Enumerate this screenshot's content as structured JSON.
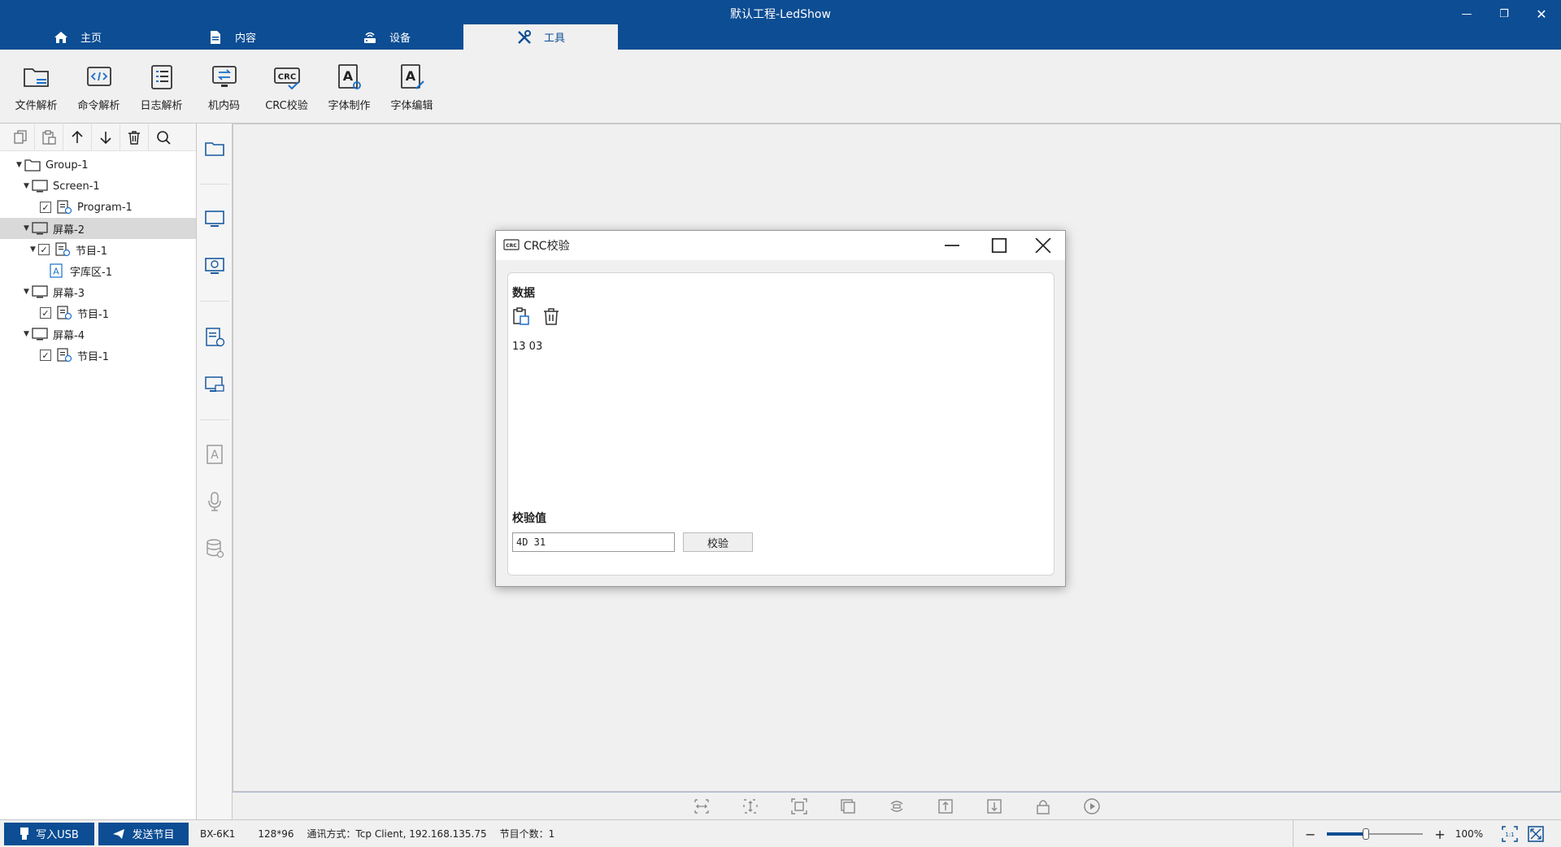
{
  "window": {
    "title": "默认工程-LedShow",
    "controls": {
      "minimize": "—",
      "restore": "❐",
      "close": "✕"
    }
  },
  "tabs": [
    {
      "label": "主页",
      "icon": "home-icon"
    },
    {
      "label": "内容",
      "icon": "document-icon"
    },
    {
      "label": "设备",
      "icon": "router-icon"
    },
    {
      "label": "工具",
      "icon": "tools-icon",
      "active": true
    }
  ],
  "ribbon": [
    {
      "label": "文件解析",
      "icon": "folder-parse-icon"
    },
    {
      "label": "命令解析",
      "icon": "code-icon"
    },
    {
      "label": "日志解析",
      "icon": "log-icon"
    },
    {
      "label": "机内码",
      "icon": "monitor-swap-icon"
    },
    {
      "label": "CRC校验",
      "icon": "crc-icon"
    },
    {
      "label": "字体制作",
      "icon": "font-make-icon"
    },
    {
      "label": "字体编辑",
      "icon": "font-edit-icon"
    }
  ],
  "tree": [
    {
      "label": "Group-1",
      "level": 0,
      "type": "group",
      "expanded": true
    },
    {
      "label": "Screen-1",
      "level": 1,
      "type": "screen",
      "expanded": true
    },
    {
      "label": "Program-1",
      "level": 2,
      "type": "program",
      "checked": true
    },
    {
      "label": "屏幕-2",
      "level": 1,
      "type": "screen",
      "expanded": true,
      "selected": true
    },
    {
      "label": "节目-1",
      "level": 2,
      "type": "program",
      "checked": true,
      "expanded": true
    },
    {
      "label": "字库区-1",
      "level": 3,
      "type": "text-area"
    },
    {
      "label": "屏幕-3",
      "level": 1,
      "type": "screen",
      "expanded": true
    },
    {
      "label": "节目-1",
      "level": 2,
      "type": "program",
      "checked": true
    },
    {
      "label": "屏幕-4",
      "level": 1,
      "type": "screen",
      "expanded": true
    },
    {
      "label": "节目-1",
      "level": 2,
      "type": "program",
      "checked": true
    }
  ],
  "dialog": {
    "title": "CRC校验",
    "data_label": "数据",
    "data_value": "13 03",
    "checksum_label": "校验值",
    "checksum_value": "4D 31",
    "verify_button": "校验"
  },
  "statusbar": {
    "write_usb": "写入USB",
    "send_program": "发送节目",
    "model": "BX-6K1",
    "resolution": "128*96",
    "comm": "通讯方式：Tcp Client, 192.168.135.75",
    "program_count": "节目个数：1",
    "zoom": "100%",
    "zoom_fraction": 0.4,
    "zoom_minus": "−",
    "zoom_plus": "+"
  },
  "colors": {
    "brand": "#0c4d93",
    "background": "#f0f0f0",
    "selected_row": "#d9d9d9"
  }
}
